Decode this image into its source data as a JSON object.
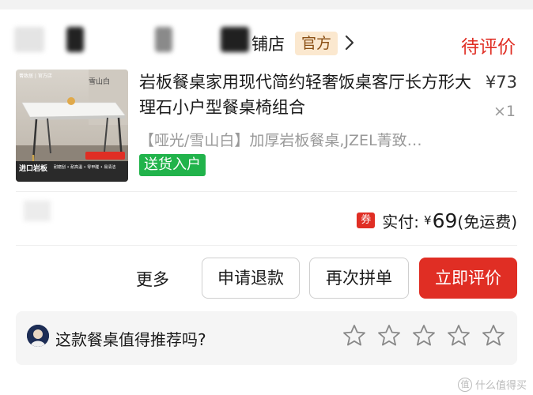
{
  "shop": {
    "name_partial": "铺店",
    "badge": "官方",
    "status": "待评价"
  },
  "product": {
    "title": "岩板餐桌家用现代简约轻奢饭桌客厅长方形大理石小户型餐桌椅组合",
    "price": "¥73",
    "quantity": "×1",
    "spec": "【哑光/雪山白】加厚岩板餐桌,JZEL菁致…",
    "delivery_tag": "送货入户",
    "thumbnail": {
      "brand": "菁致居 | 官方店",
      "corner_text": "雪山白",
      "promo_big": "进口岩板",
      "promo_line": "耐磨刮 • 耐高温 • 零甲醛 • 易清洁"
    }
  },
  "payment": {
    "coupon_icon": "券",
    "label": "实付:",
    "currency": "¥",
    "amount": "69",
    "note": "(免运费)"
  },
  "actions": {
    "more": "更多",
    "refund": "申请退款",
    "regroup": "再次拼单",
    "review": "立即评价"
  },
  "rating": {
    "question": "这款餐桌值得推荐吗?",
    "stars": 5
  },
  "watermark": "什么值得买",
  "colors": {
    "accent": "#e02e24",
    "badge_bg": "#fbe8cf",
    "badge_text": "#8a4f14",
    "delivery_green": "#21b34b"
  },
  "icons": [
    "chevron-right-icon",
    "coupon-icon",
    "star-outline-icon",
    "avatar"
  ]
}
